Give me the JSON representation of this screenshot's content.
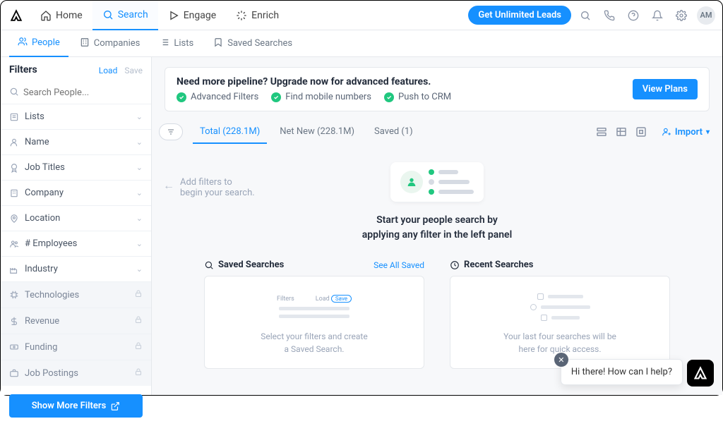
{
  "topnav": {
    "items": [
      {
        "label": "Home"
      },
      {
        "label": "Search"
      },
      {
        "label": "Engage"
      },
      {
        "label": "Enrich"
      }
    ],
    "cta": "Get Unlimited Leads",
    "avatar": "AM"
  },
  "subnav": {
    "items": [
      {
        "label": "People"
      },
      {
        "label": "Companies"
      },
      {
        "label": "Lists"
      },
      {
        "label": "Saved Searches"
      }
    ]
  },
  "sidebar": {
    "title": "Filters",
    "load": "Load",
    "save": "Save",
    "search_placeholder": "Search People...",
    "filters": [
      {
        "label": "Lists"
      },
      {
        "label": "Name"
      },
      {
        "label": "Job Titles"
      },
      {
        "label": "Company"
      },
      {
        "label": "Location"
      },
      {
        "label": "# Employees"
      },
      {
        "label": "Industry"
      }
    ],
    "locked": [
      {
        "label": "Technologies"
      },
      {
        "label": "Revenue"
      },
      {
        "label": "Funding"
      },
      {
        "label": "Job Postings"
      }
    ],
    "show_more": "Show More Filters"
  },
  "banner": {
    "headline": "Need more pipeline? Upgrade now for advanced features.",
    "features": [
      "Advanced Filters",
      "Find mobile numbers",
      "Push to CRM"
    ],
    "cta": "View Plans"
  },
  "tabs": {
    "items": [
      {
        "label": "Total (228.1M)"
      },
      {
        "label": "Net New (228.1M)"
      },
      {
        "label": "Saved (1)"
      }
    ],
    "import": "Import"
  },
  "hint": {
    "line1": "Add filters to",
    "line2": "begin your search."
  },
  "empty": {
    "line1": "Start your people search by",
    "line2": "applying any filter in the left panel"
  },
  "cards": {
    "saved": {
      "title": "Saved Searches",
      "link": "See All Saved",
      "ill_filters": "Filters",
      "ill_load": "Load",
      "ill_save": "Save",
      "desc1": "Select your filters and create",
      "desc2": "a Saved Search."
    },
    "recent": {
      "title": "Recent Searches",
      "desc1": "Your last four searches will be",
      "desc2": "here for quick access."
    }
  },
  "chat": {
    "text": "Hi there! How can I help?"
  }
}
